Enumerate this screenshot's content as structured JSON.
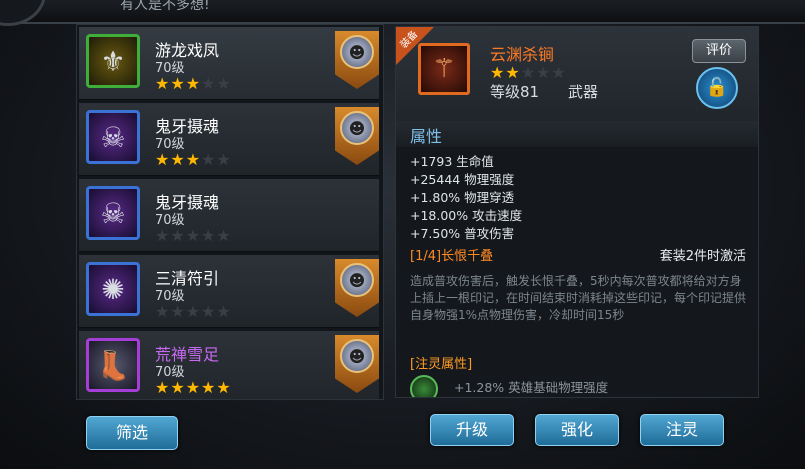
{
  "header": {
    "title": "有人是不多想!"
  },
  "items": [
    {
      "name": "游龙戏凤",
      "level": "70级",
      "stars": 3,
      "max_stars": 5,
      "name_color": "#ffffff",
      "icon": "dragon-bracelet-icon",
      "frame": "green",
      "hero_icon": "hero-portrait-icon"
    },
    {
      "name": "鬼牙摄魂",
      "level": "70级",
      "stars": 3,
      "max_stars": 5,
      "name_color": "#ffffff",
      "icon": "ghost-fang-necklace-icon",
      "frame": "blue",
      "hero_icon": "hero-portrait-icon"
    },
    {
      "name": "鬼牙摄魂",
      "level": "70级",
      "stars": 0,
      "max_stars": 5,
      "name_color": "#ffffff",
      "icon": "ghost-fang-necklace-icon",
      "frame": "blue",
      "hero_icon": null
    },
    {
      "name": "三清符引",
      "level": "70级",
      "stars": 0,
      "max_stars": 5,
      "name_color": "#ffffff",
      "icon": "talisman-amulet-icon",
      "frame": "blue",
      "hero_icon": "hero-portrait-icon"
    },
    {
      "name": "荒禅雪足",
      "level": "70级",
      "stars": 5,
      "max_stars": 5,
      "name_color": "#c86af0",
      "icon": "snow-boots-icon",
      "frame": "purple",
      "hero_icon": "hero-portrait-icon"
    }
  ],
  "filter_label": "筛选",
  "detail": {
    "corner_tag": "装备",
    "name": "云渊杀锏",
    "stars": 2,
    "max_stars": 5,
    "level": "等级81",
    "type": "武器",
    "rate_label": "评价",
    "lock_icon": "unlock-icon",
    "attr_title": "属性",
    "stats": [
      "+1793 生命值",
      "+25444 物理强度",
      "+1.80% 物理穿透",
      "+18.00% 攻击速度",
      "+7.50% 普攻伤害"
    ],
    "set_name": "[1/4]长恨千叠",
    "set_note": "套装2件时激活",
    "set_desc": "造成普攻伤害后，触发长恨千叠，5秒内每次普攻都将给对方身上插上一根印记，在时间结束时消耗掉这些印记，每个印记提供自身物强1%点物理伤害，冷却时间15秒",
    "infuse_title": "[注灵属性]",
    "infuse_stat": "+1.28% 英雄基础物理强度"
  },
  "actions": {
    "upgrade": "升级",
    "enhance": "强化",
    "infuse": "注灵"
  },
  "colors": {
    "accent_orange": "#ff7a24",
    "attr_blue": "#7fc0e8",
    "star": "#ffb800",
    "button_blue": "#2f86b8"
  }
}
